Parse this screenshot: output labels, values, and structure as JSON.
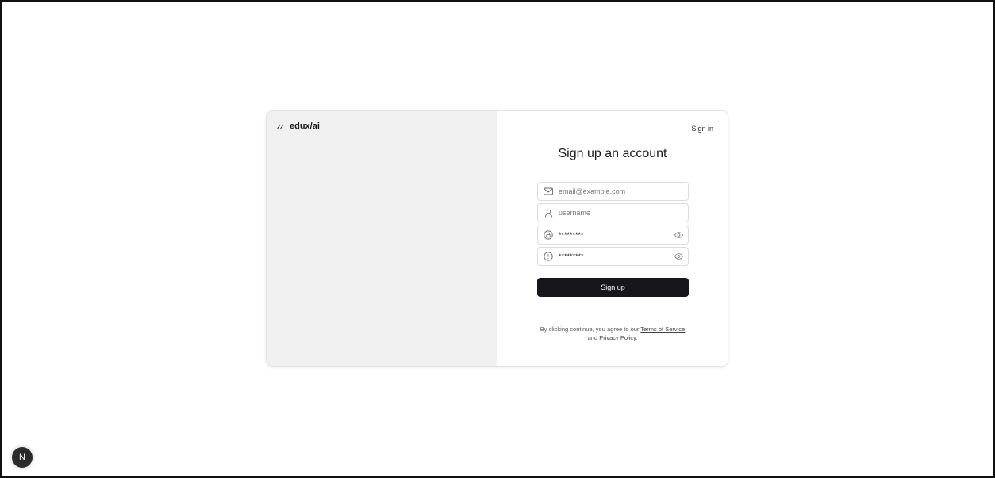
{
  "brand": {
    "name": "edux/ai",
    "icon": "slashes-logo-icon"
  },
  "header": {
    "signin_label": "Sign in"
  },
  "form": {
    "title": "Sign up an account",
    "email": {
      "placeholder": "email@example.com",
      "icon": "mail-icon"
    },
    "username": {
      "placeholder": "username",
      "icon": "user-icon"
    },
    "password": {
      "value": "*********",
      "icon": "lock-icon",
      "toggle_icon": "eye-icon"
    },
    "confirm_password": {
      "value": "*********",
      "icon": "info-icon",
      "toggle_icon": "eye-icon"
    },
    "submit_label": "Sign up"
  },
  "terms": {
    "prefix": "By clicking continue, you agree to our",
    "tos_label": "Terms of Service",
    "and": "and",
    "privacy_label": "Privacy Policy",
    "suffix": "."
  },
  "dev_badge": {
    "label": "N"
  },
  "colors": {
    "button_bg": "#17171b",
    "panel_bg": "#f0f0f0"
  }
}
